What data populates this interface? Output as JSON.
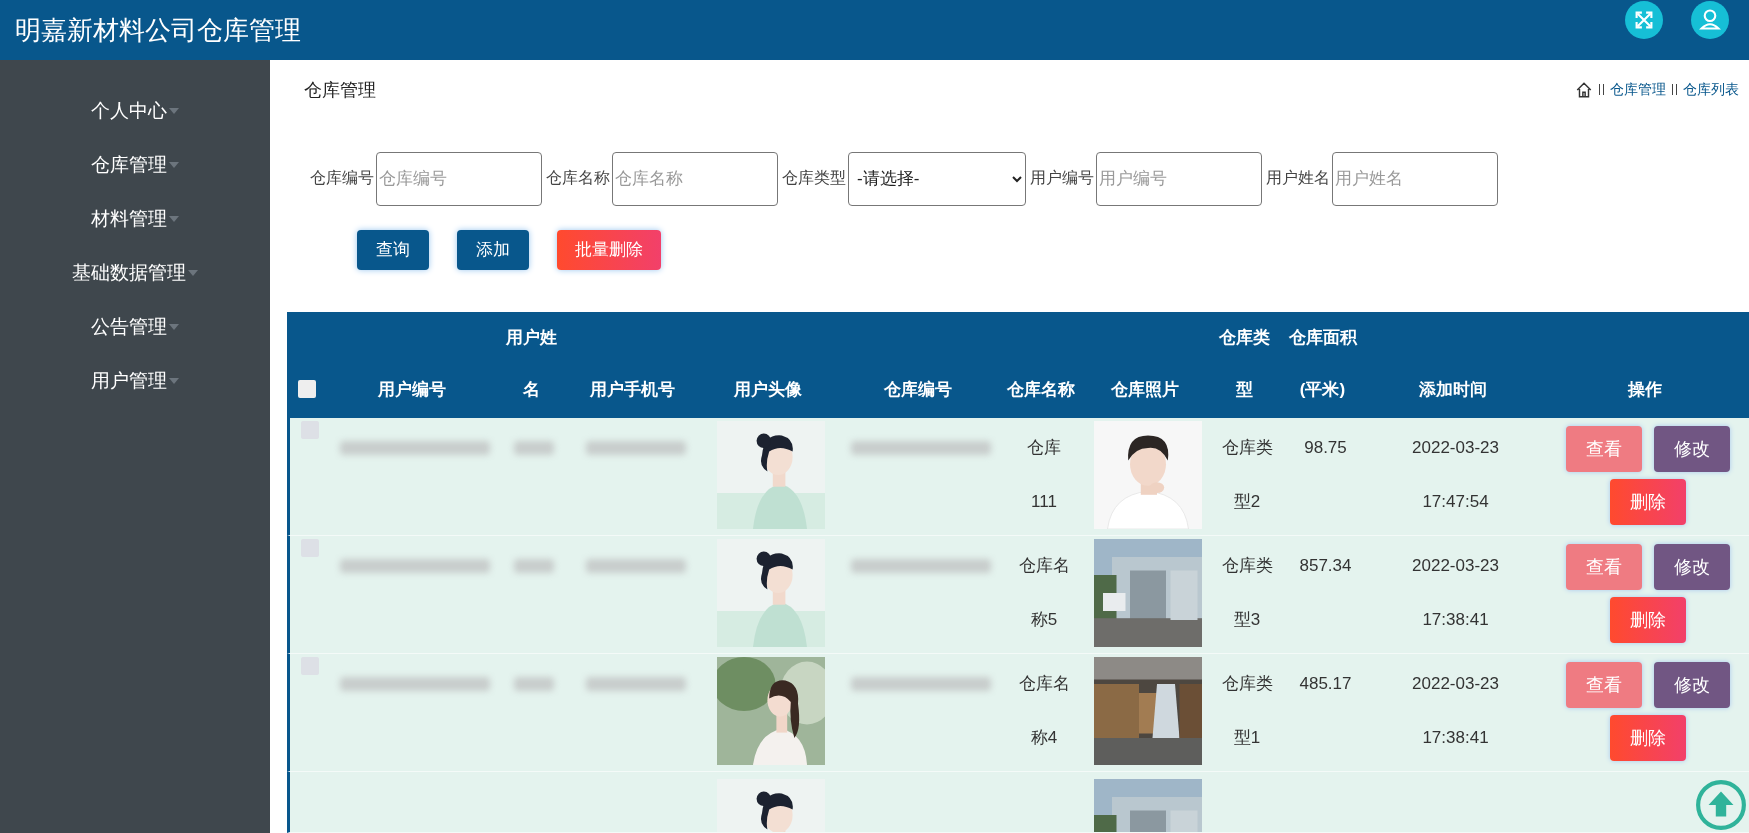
{
  "header": {
    "title": "明嘉新材料公司仓库管理"
  },
  "sidebar": {
    "items": [
      {
        "label": "个人中心",
        "expanded": false
      },
      {
        "label": "仓库管理",
        "expanded": false
      },
      {
        "label": "材料管理",
        "expanded": false
      },
      {
        "label": "基础数据管理",
        "expanded": false
      },
      {
        "label": "公告管理",
        "expanded": false
      },
      {
        "label": "用户管理",
        "expanded": false
      }
    ]
  },
  "page_title": "仓库管理",
  "breadcrumb": [
    "仓库管理",
    "仓库列表"
  ],
  "filters": [
    {
      "label": "仓库编号",
      "kind": "text",
      "placeholder": "仓库编号"
    },
    {
      "label": "仓库名称",
      "kind": "text",
      "placeholder": "仓库名称"
    },
    {
      "label": "仓库类型",
      "kind": "select",
      "value": "-请选择-"
    },
    {
      "label": "用户编号",
      "kind": "text",
      "placeholder": "用户编号"
    },
    {
      "label": "用户姓名",
      "kind": "text",
      "placeholder": "用户姓名"
    }
  ],
  "actions": [
    {
      "label": "查询",
      "kind": "primary"
    },
    {
      "label": "添加",
      "kind": "primary"
    },
    {
      "label": "批量删除",
      "kind": "danger"
    }
  ],
  "table": {
    "select_all_checked": false,
    "columns": [
      "用户编号",
      "用户姓名",
      "用户手机号",
      "用户头像",
      "仓库编号",
      "仓库名称",
      "仓库照片",
      "仓库类型",
      "仓库面积(平米)",
      "添加时间",
      "操作"
    ],
    "rows": [
      {
        "checked": false,
        "warehouse_name": "仓库111",
        "warehouse_type": "仓库类型2",
        "area": "98.75",
        "added": "2022-03-23 17:47:54",
        "buttons": [
          "查看",
          "修改",
          "删除"
        ]
      },
      {
        "checked": false,
        "warehouse_name": "仓库名称5",
        "warehouse_type": "仓库类型3",
        "area": "857.34",
        "added": "2022-03-23 17:38:41",
        "buttons": [
          "查看",
          "修改",
          "删除"
        ]
      },
      {
        "checked": false,
        "warehouse_name": "仓库名称4",
        "warehouse_type": "仓库类型1",
        "area": "485.17",
        "added": "2022-03-23 17:38:41",
        "buttons": [
          "查看",
          "修改",
          "删除"
        ]
      }
    ]
  }
}
